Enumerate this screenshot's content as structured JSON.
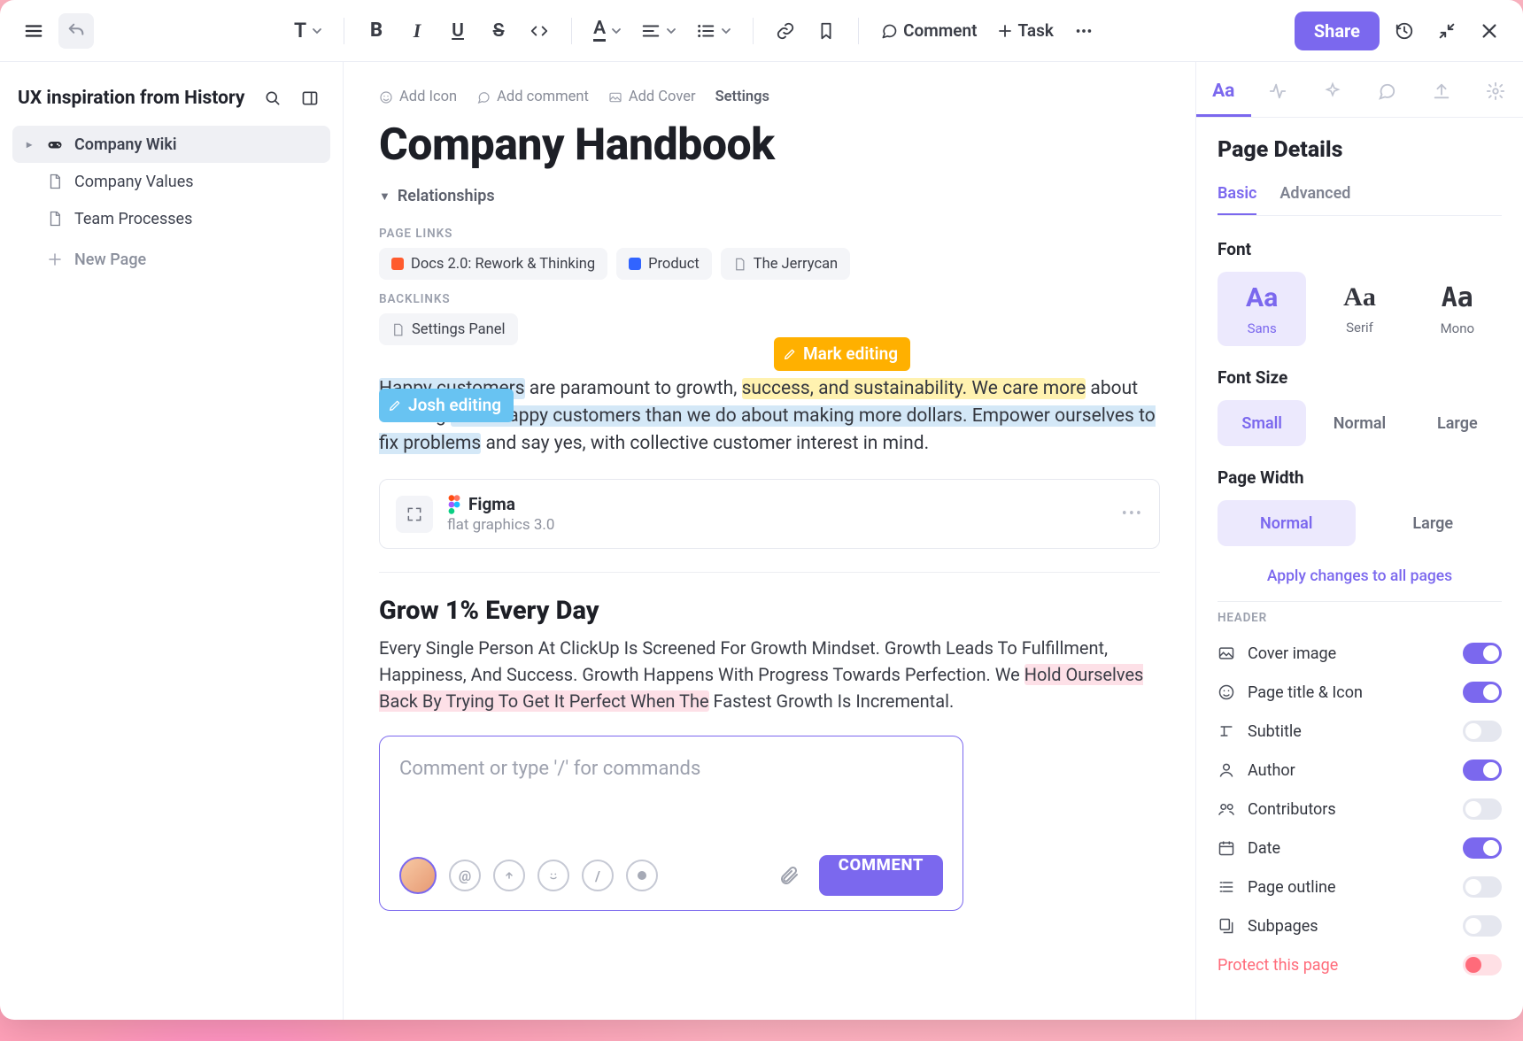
{
  "toolbar": {
    "comment": "Comment",
    "task": "Task",
    "share": "Share"
  },
  "sidebar": {
    "title": "UX inspiration from History",
    "items": [
      {
        "label": "Company Wiki"
      },
      {
        "label": "Company Values"
      },
      {
        "label": "Team Processes"
      }
    ],
    "newPage": "New Page"
  },
  "doc": {
    "actions": {
      "addIcon": "Add Icon",
      "addComment": "Add comment",
      "addCover": "Add Cover",
      "settings": "Settings"
    },
    "title": "Company Handbook",
    "relationships": "Relationships",
    "pageLinksLabel": "PAGE LINKS",
    "pageLinks": [
      {
        "label": "Docs 2.0: Rework & Thinking",
        "color": "#ff5b2e"
      },
      {
        "label": "Product",
        "color": "#3164ff"
      },
      {
        "label": "The Jerrycan",
        "color": "#b0b4be"
      }
    ],
    "backlinksLabel": "BACKLINKS",
    "backlinks": [
      {
        "label": "Settings Panel"
      }
    ],
    "tags": {
      "mark": "Mark editing",
      "josh": "Josh editing"
    },
    "p1_a": "Happy customers",
    "p1_b": " are paramount to growth, ",
    "p1_c": "success, and sustainability. We care more",
    "p1_d": " about creating ",
    "p1_e": "more happy customers than we do about making more dollars. Empower ourselves to fix problems",
    "p1_f": " and say yes, with collective customer interest in mind.",
    "embed": {
      "name": "Figma",
      "sub": "flat graphics 3.0"
    },
    "h2": "Grow 1% Every Day",
    "p2_a": "Every Single Person At ClickUp Is Screened For Growth Mindset. Growth Leads To Fulfillment, Happiness, And Success. Growth Happens With Progress Towards Perfection. We ",
    "p2_b": "Hold Ourselves Back By Trying To Get It Perfect When The",
    "p2_c": " Fastest Growth Is Incremental.",
    "comment": {
      "placeholder": "Comment or type '/' for commands",
      "submit": "COMMENT"
    }
  },
  "panel": {
    "title": "Page Details",
    "basic": "Basic",
    "advanced": "Advanced",
    "font": "Font",
    "sans": "Sans",
    "serif": "Serif",
    "mono": "Mono",
    "fontSize": "Font Size",
    "small": "Small",
    "normal": "Normal",
    "large": "Large",
    "pageWidth": "Page Width",
    "normalW": "Normal",
    "largeW": "Large",
    "applyAll": "Apply changes to all pages",
    "header": "HEADER",
    "opts": {
      "cover": "Cover image",
      "titleIcon": "Page title & Icon",
      "subtitle": "Subtitle",
      "author": "Author",
      "contributors": "Contributors",
      "date": "Date",
      "outline": "Page outline",
      "subpages": "Subpages"
    },
    "protect": "Protect this page"
  }
}
